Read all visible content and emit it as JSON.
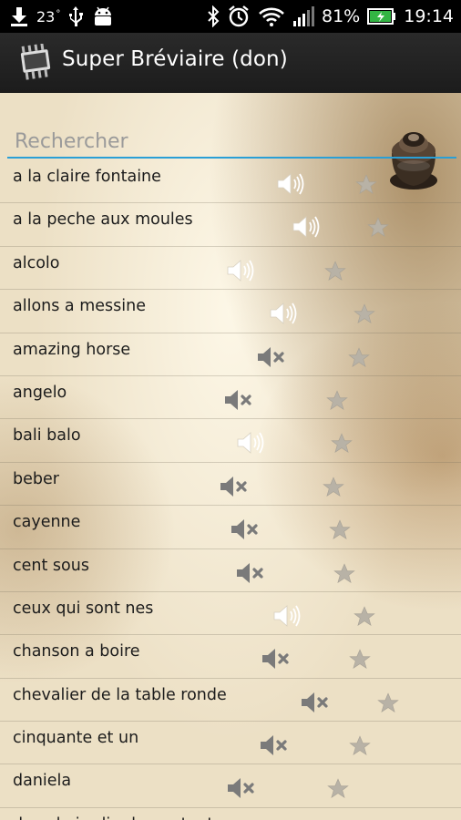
{
  "status_bar": {
    "temperature": "23",
    "temperature_unit": "°",
    "battery": "81%",
    "time": "19:14",
    "icons": [
      "download-icon",
      "usb-icon",
      "android-icon",
      "bluetooth-icon",
      "alarm-icon",
      "wifi-icon",
      "signal-icon",
      "battery-charging-icon"
    ]
  },
  "action_bar": {
    "app_icon": "chip-icon",
    "title": "Super Bréviaire (don)"
  },
  "search": {
    "placeholder": "Rechercher",
    "value": ""
  },
  "songs": [
    {
      "title": "a la claire fontaine",
      "audio": true,
      "favorite": false
    },
    {
      "title": "a la peche aux moules",
      "audio": true,
      "favorite": false
    },
    {
      "title": "alcolo",
      "audio": true,
      "favorite": false
    },
    {
      "title": "allons a messine",
      "audio": true,
      "favorite": false
    },
    {
      "title": "amazing horse",
      "audio": false,
      "favorite": false
    },
    {
      "title": "angelo",
      "audio": false,
      "favorite": false
    },
    {
      "title": "bali balo",
      "audio": true,
      "favorite": false
    },
    {
      "title": "beber",
      "audio": false,
      "favorite": false
    },
    {
      "title": "cayenne",
      "audio": false,
      "favorite": false
    },
    {
      "title": "cent sous",
      "audio": false,
      "favorite": false
    },
    {
      "title": "ceux qui sont nes",
      "audio": true,
      "favorite": false
    },
    {
      "title": "chanson a boire",
      "audio": false,
      "favorite": false
    },
    {
      "title": "chevalier de la table ronde",
      "audio": false,
      "favorite": false
    },
    {
      "title": "cinquante et un",
      "audio": false,
      "favorite": false
    },
    {
      "title": "daniela",
      "audio": false,
      "favorite": false
    },
    {
      "title": "dans le jardin de ma tante",
      "audio": false,
      "favorite": false
    }
  ],
  "colors": {
    "search_underline": "#2a9fd6",
    "audio_on": "#ffffff",
    "audio_off": "#7a7a7a",
    "star": "#b8b2a6"
  }
}
